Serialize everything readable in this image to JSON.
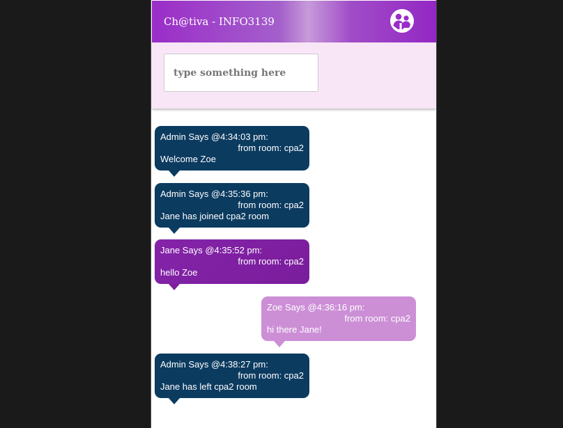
{
  "header": {
    "title": "Ch@tiva - INFO3139",
    "icon": "people-icon"
  },
  "composer": {
    "placeholder": "type something here",
    "value": ""
  },
  "colors": {
    "admin": "#0c3b60",
    "jane": "#7d1f9e",
    "zoe": "#cc8fd6",
    "panel": "#f8e6f7"
  },
  "messages": [
    {
      "header": "Admin Says @4:34:03 pm:",
      "room": "from room: cpa2",
      "text": "Welcome Zoe",
      "sender": "admin",
      "align": "left"
    },
    {
      "header": "Admin Says @4:35:36 pm:",
      "room": "from room: cpa2",
      "text": "Jane has joined cpa2 room",
      "sender": "admin",
      "align": "left"
    },
    {
      "header": "Jane Says @4:35:52 pm:",
      "room": "from room: cpa2",
      "text": "hello Zoe",
      "sender": "jane",
      "align": "left"
    },
    {
      "header": "Zoe Says @4:36:16 pm:",
      "room": "from room: cpa2",
      "text": "hi there Jane!",
      "sender": "zoe",
      "align": "right"
    },
    {
      "header": "Admin Says @4:38:27 pm:",
      "room": "from room: cpa2",
      "text": "Jane has left cpa2 room",
      "sender": "admin",
      "align": "left"
    }
  ]
}
